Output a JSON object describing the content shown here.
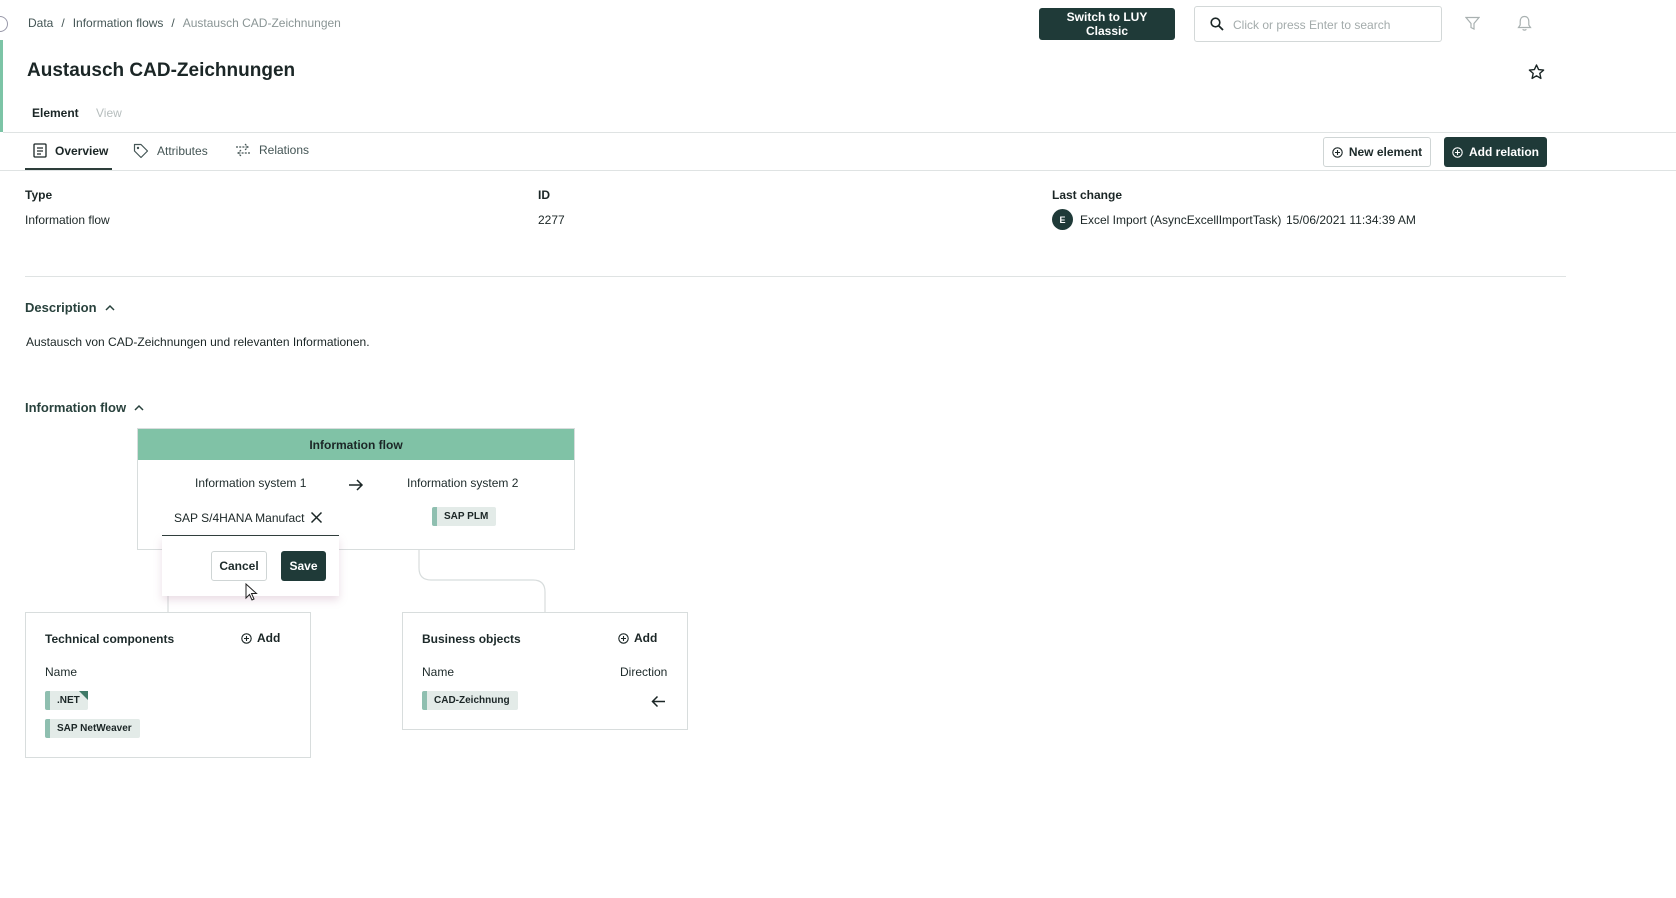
{
  "breadcrumb": {
    "items": [
      "Data",
      "Information flows"
    ],
    "current": "Austausch CAD-Zeichnungen",
    "separator": "/"
  },
  "header": {
    "switch_label": "Switch to LUY Classic",
    "search_placeholder": "Click or press Enter to search",
    "icons": [
      "search-icon",
      "filter-icon",
      "bell-icon",
      "star-icon"
    ]
  },
  "page": {
    "title": "Austausch CAD-Zeichnungen",
    "subtabs": [
      "Element",
      "View"
    ]
  },
  "tabs": [
    {
      "label": "Overview",
      "icon": "document-icon",
      "active": true
    },
    {
      "label": "Attributes",
      "icon": "tag-icon",
      "active": false
    },
    {
      "label": "Relations",
      "icon": "swap-icon",
      "active": false
    }
  ],
  "actions": {
    "new_element": "New element",
    "add_relation": "Add relation"
  },
  "meta": {
    "type_label": "Type",
    "type_value": "Information flow",
    "id_label": "ID",
    "id_value": "2277",
    "change_label": "Last change",
    "change_avatar": "E",
    "change_user": "Excel Import (AsyncExcellImportTask)",
    "change_date": "15/06/2021 11:34:39 AM"
  },
  "description": {
    "heading": "Description",
    "text": "Austausch von CAD-Zeichnungen und relevanten Informationen."
  },
  "flow": {
    "heading": "Information flow",
    "box_title": "Information flow",
    "system1_label": "Information system 1",
    "system2_label": "Information system 2",
    "system1_value": "SAP S/4HANA Manufact",
    "system2_tag": "SAP PLM",
    "cancel_label": "Cancel",
    "save_label": "Save"
  },
  "technical": {
    "title": "Technical components",
    "add_label": "Add",
    "name_header": "Name",
    "items": [
      ".NET",
      "SAP NetWeaver"
    ]
  },
  "business": {
    "title": "Business objects",
    "add_label": "Add",
    "name_header": "Name",
    "direction_header": "Direction",
    "items": [
      "CAD-Zeichnung"
    ]
  },
  "colors": {
    "accent": "#7cc4a6",
    "dark": "#1f3a38",
    "tag_bg": "#e3ebe8"
  }
}
